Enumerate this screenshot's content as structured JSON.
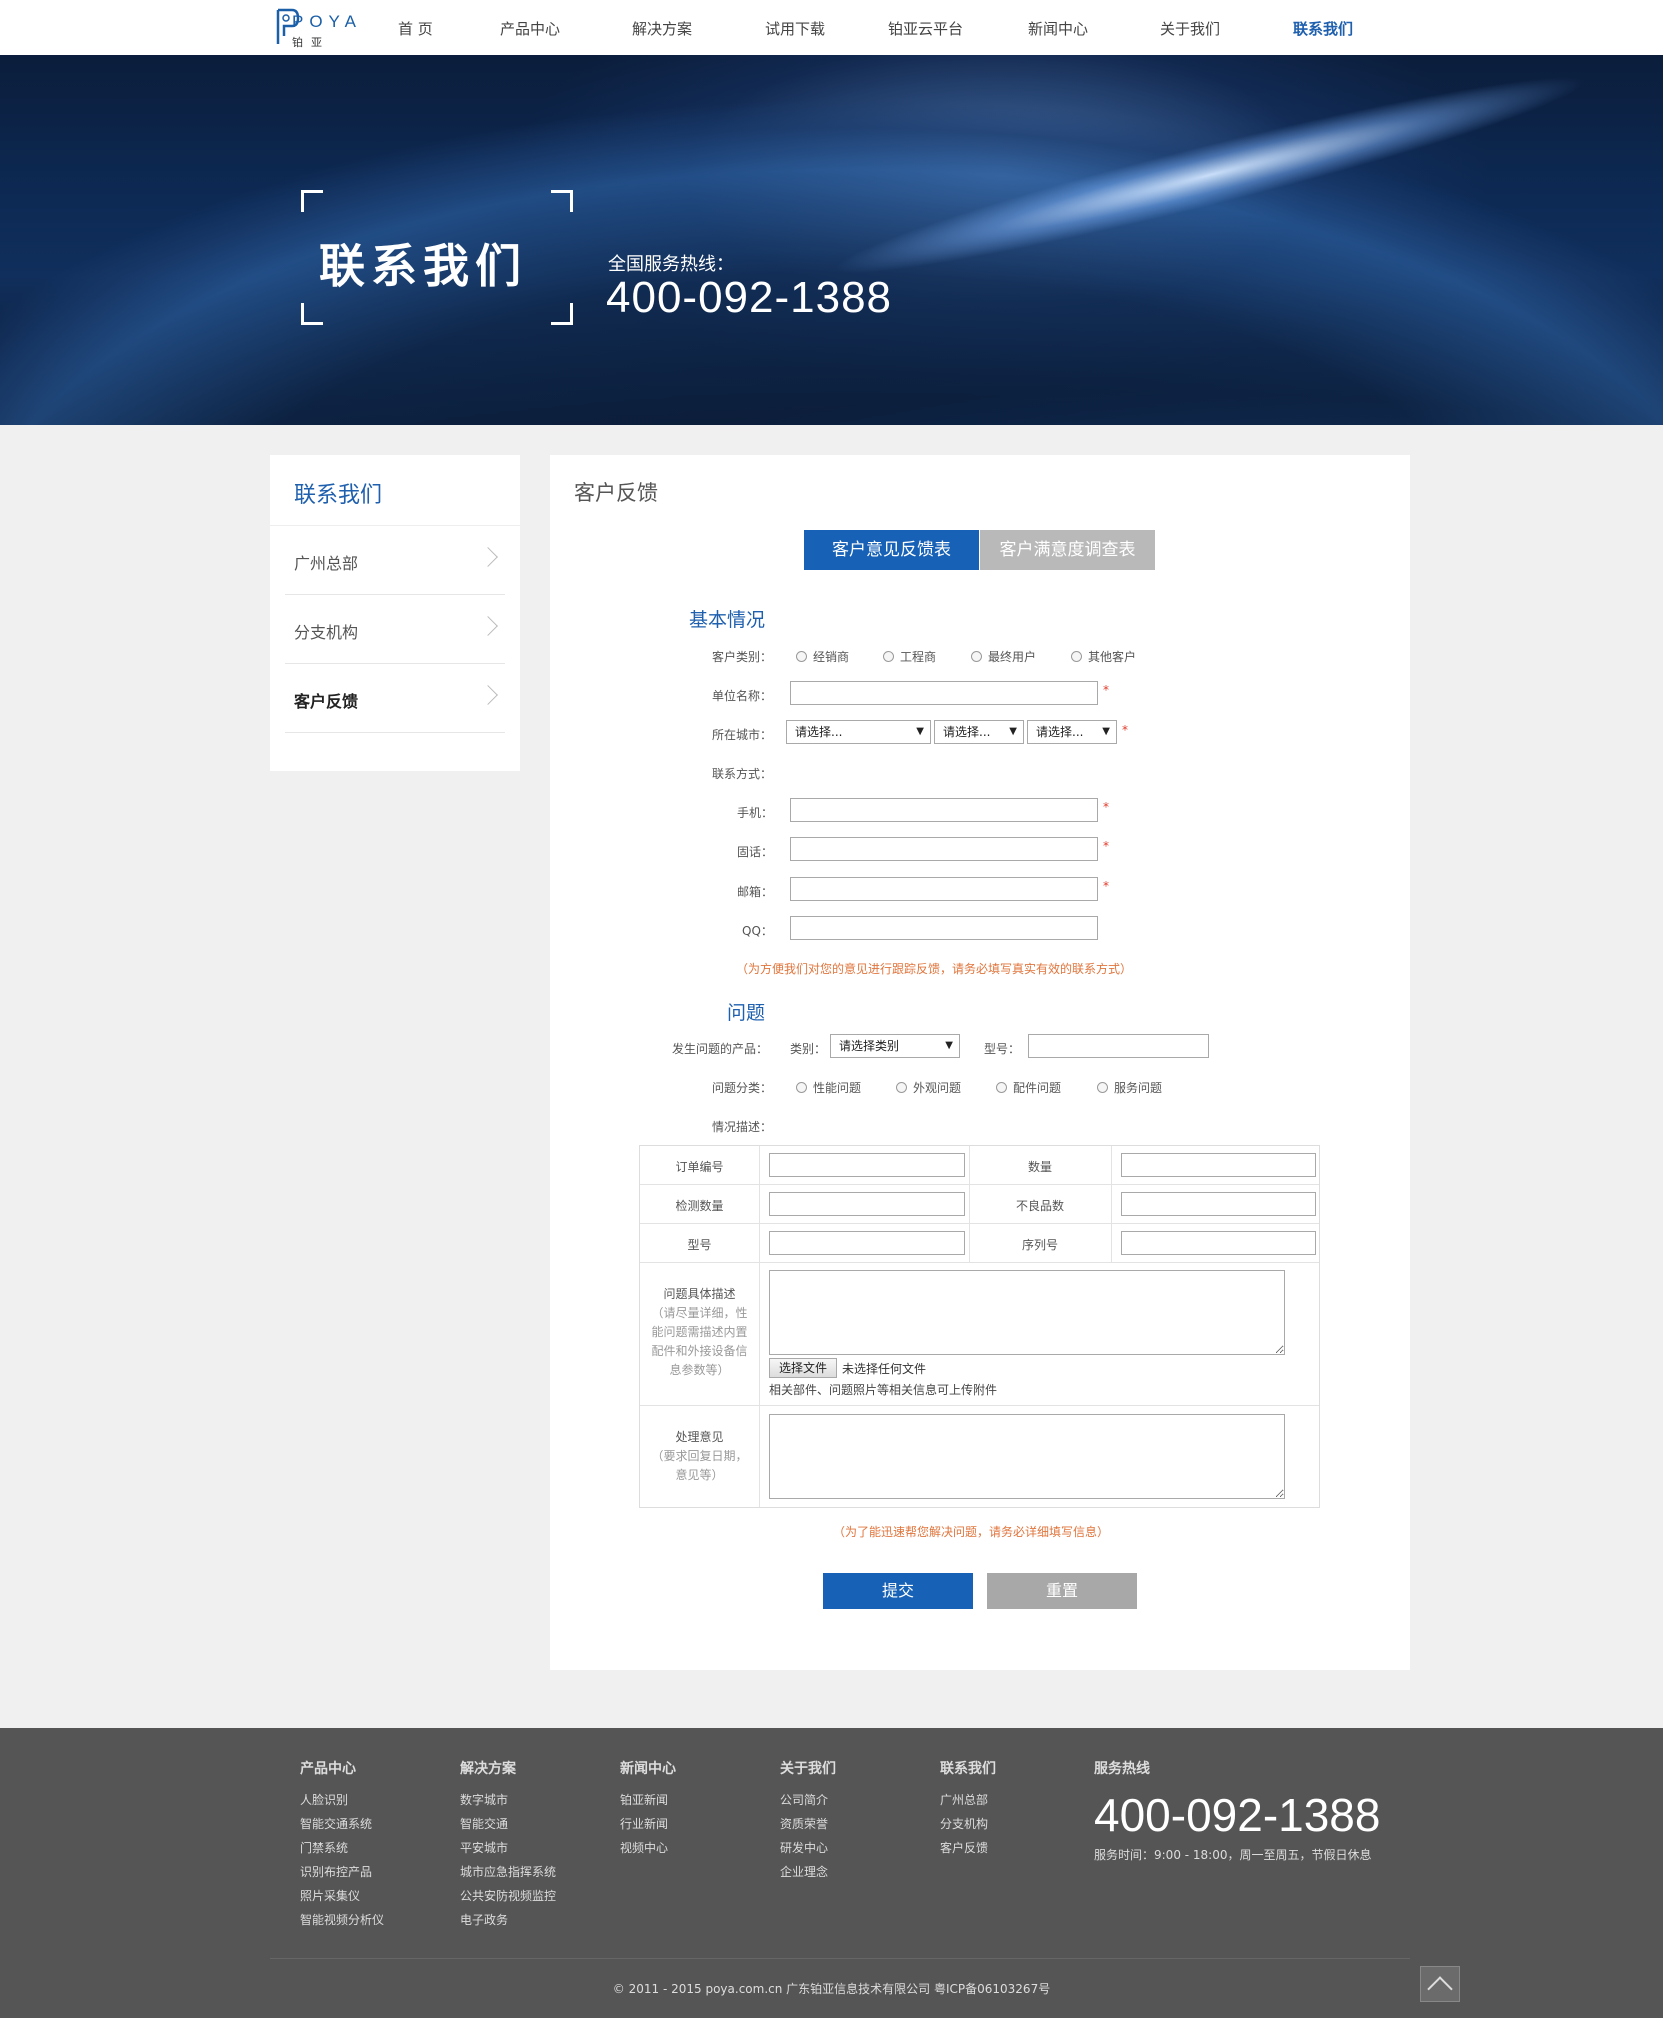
{
  "header": {
    "logo_letters": "POYA",
    "logo_sub": "铂亚",
    "nav": [
      "首 页",
      "产品中心",
      "解决方案",
      "试用下载",
      "铂亚云平台",
      "新闻中心",
      "关于我们",
      "联系我们"
    ],
    "active_nav": "联系我们"
  },
  "banner": {
    "title": "联系我们",
    "hotline_label": "全国服务热线：",
    "hotline_number": "400-092-1388"
  },
  "sidebar": {
    "title": "联系我们",
    "items": [
      "广州总部",
      "分支机构",
      "客户反馈"
    ],
    "active_item": "客户反馈"
  },
  "main": {
    "title": "客户反馈",
    "tabs": [
      "客户意见反馈表",
      "客户满意度调查表"
    ],
    "basic": {
      "section_title": "基本情况",
      "customer_type_label": "客户类别：",
      "customer_types": [
        "经销商",
        "工程商",
        "最终用户",
        "其他客户"
      ],
      "company_label": "单位名称：",
      "city_label": "所在城市：",
      "city_selects": [
        "请选择...",
        "请选择...",
        "请选择..."
      ],
      "contact_label": "联系方式：",
      "mobile_label": "手机：",
      "phone_label": "固话：",
      "email_label": "邮箱：",
      "qq_label": "QQ：",
      "required_mark": "*",
      "contact_note": "（为方便我们对您的意见进行跟踪反馈，请务必填写真实有效的联系方式）"
    },
    "problem": {
      "section_title": "问题",
      "product_label": "发生问题的产品：",
      "category_label": "类别：",
      "category_select": "请选择类别",
      "model_label": "型号：",
      "type_label": "问题分类：",
      "types": [
        "性能问题",
        "外观问题",
        "配件问题",
        "服务问题"
      ],
      "desc_label": "情况描述："
    },
    "table": {
      "order_no": "订单编号",
      "quantity": "数量",
      "inspected": "检测数量",
      "defective": "不良品数",
      "model": "型号",
      "serial": "序列号",
      "detail_title": "问题具体描述",
      "detail_hint": "（请尽量详细，性能问题需描述内置配件和外接设备信息参数等）",
      "file_button": "选择文件",
      "file_status": "未选择任何文件",
      "file_hint": "相关部件、问题照片等相关信息可上传附件",
      "handle_title": "处理意见",
      "handle_hint": "（要求回复日期，意见等）"
    },
    "bottom_note": "（为了能迅速帮您解决问题，请务必详细填写信息）",
    "submit": "提交",
    "reset": "重置"
  },
  "footer": {
    "columns": [
      {
        "title": "产品中心",
        "links": [
          "人脸识别",
          "智能交通系统",
          "门禁系统",
          "识别布控产品",
          "照片采集仪",
          "智能视频分析仪"
        ]
      },
      {
        "title": "解决方案",
        "links": [
          "数字城市",
          "智能交通",
          "平安城市",
          "城市应急指挥系统",
          "公共安防视频监控",
          "电子政务"
        ]
      },
      {
        "title": "新闻中心",
        "links": [
          "铂亚新闻",
          "行业新闻",
          "视频中心"
        ]
      },
      {
        "title": "关于我们",
        "links": [
          "公司简介",
          "资质荣誉",
          "研发中心",
          "企业理念"
        ]
      },
      {
        "title": "联系我们",
        "links": [
          "广州总部",
          "分支机构",
          "客户反馈"
        ]
      }
    ],
    "hotline_title": "服务热线",
    "hotline_number": "400-092-1388",
    "hours": "服务时间：9:00 - 18:00，周一至周五，节假日休息",
    "copyright": "© 2011 - 2015 poya.com.cn 广东铂亚信息技术有限公司 粤ICP备06103267号"
  },
  "colors": {
    "brand_blue": "#1762b7",
    "header_active": "#1e5fae",
    "note_orange": "#e0753c",
    "required_red": "#e03c2a",
    "footer_bg": "#555555"
  }
}
